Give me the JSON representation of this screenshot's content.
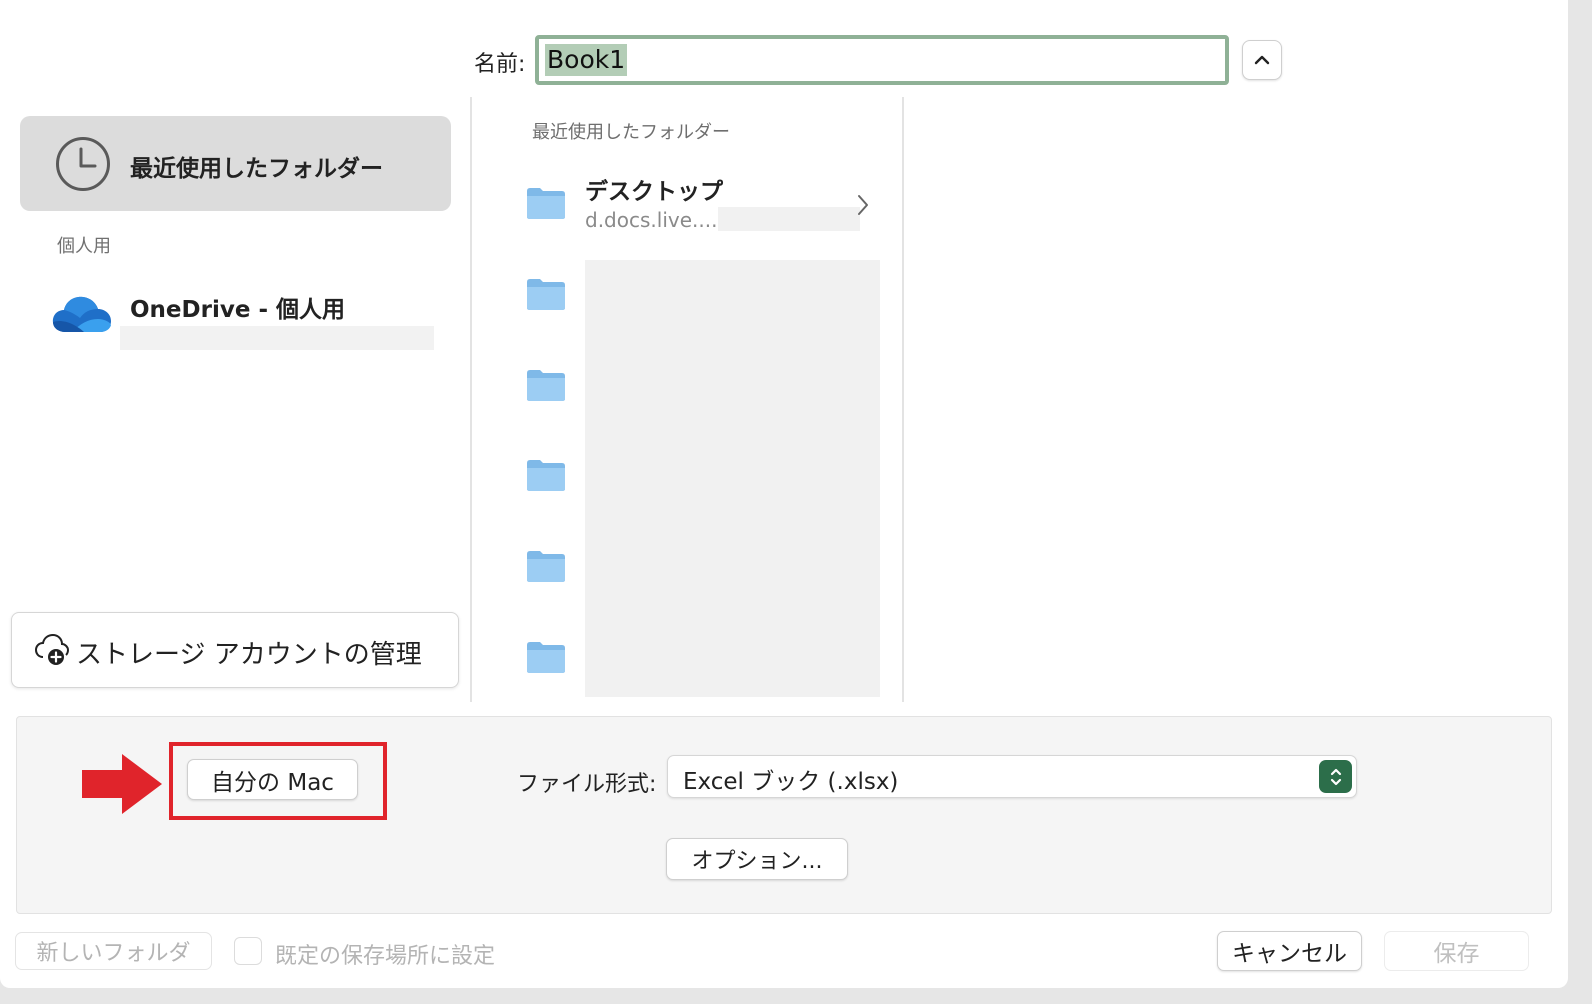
{
  "header": {
    "name_label": "名前:",
    "filename": "Book1"
  },
  "sidebar": {
    "recent_label": "最近使用したフォルダー",
    "personal_section": "個人用",
    "onedrive_label": "OneDrive - 個人用",
    "storage_button": "ストレージ アカウントの管理"
  },
  "browser": {
    "column_header": "最近使用したフォルダー",
    "items": [
      {
        "title": "デスクトップ",
        "subtitle": "d.docs.live...."
      }
    ]
  },
  "format_pane": {
    "my_mac_button": "自分の Mac",
    "file_format_label": "ファイル形式:",
    "file_format_value": "Excel ブック (.xlsx)",
    "options_button": "オプション..."
  },
  "footer": {
    "new_folder_button": "新しいフォルダ",
    "default_location_label": "既定の保存場所に設定",
    "cancel_button": "キャンセル",
    "save_button": "保存"
  },
  "colors": {
    "selection": "#b3cdb6",
    "input_border": "#8fb196",
    "highlight": "#e0242b",
    "stepper": "#2c6e4a",
    "folder": "#8cc4ef"
  }
}
